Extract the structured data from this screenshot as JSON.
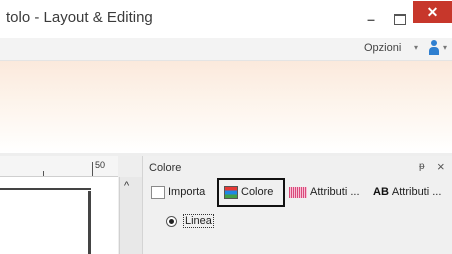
{
  "window": {
    "title": "tolo - Layout & Editing",
    "minimize_label": "–",
    "close_label": "✕"
  },
  "menu": {
    "options_label": "Opzioni",
    "options_caret": "▾",
    "user_caret": "▾"
  },
  "ruler": {
    "mark_label": "50"
  },
  "scroll": {
    "up_arrow": "^"
  },
  "panel": {
    "title": "Colore",
    "pin_glyph": "ᵽ",
    "close_glyph": "×",
    "tabs": [
      {
        "label": "Importa",
        "icon": "import-icon",
        "active": false
      },
      {
        "label": "Colore",
        "icon": "color-palette-icon",
        "active": true
      },
      {
        "label": "Attributi ...",
        "icon": "stitch-attributes-icon",
        "active": false
      },
      {
        "label": "Attributi ...",
        "icon": "text-attributes-icon",
        "icon_text": "AB",
        "active": false
      }
    ],
    "radio_option": {
      "label": "Linea",
      "selected": true
    }
  },
  "colors": {
    "close_button": "#c7372b",
    "ribbon_top": "#fbe9dc",
    "user_icon": "#2f7fd0"
  }
}
